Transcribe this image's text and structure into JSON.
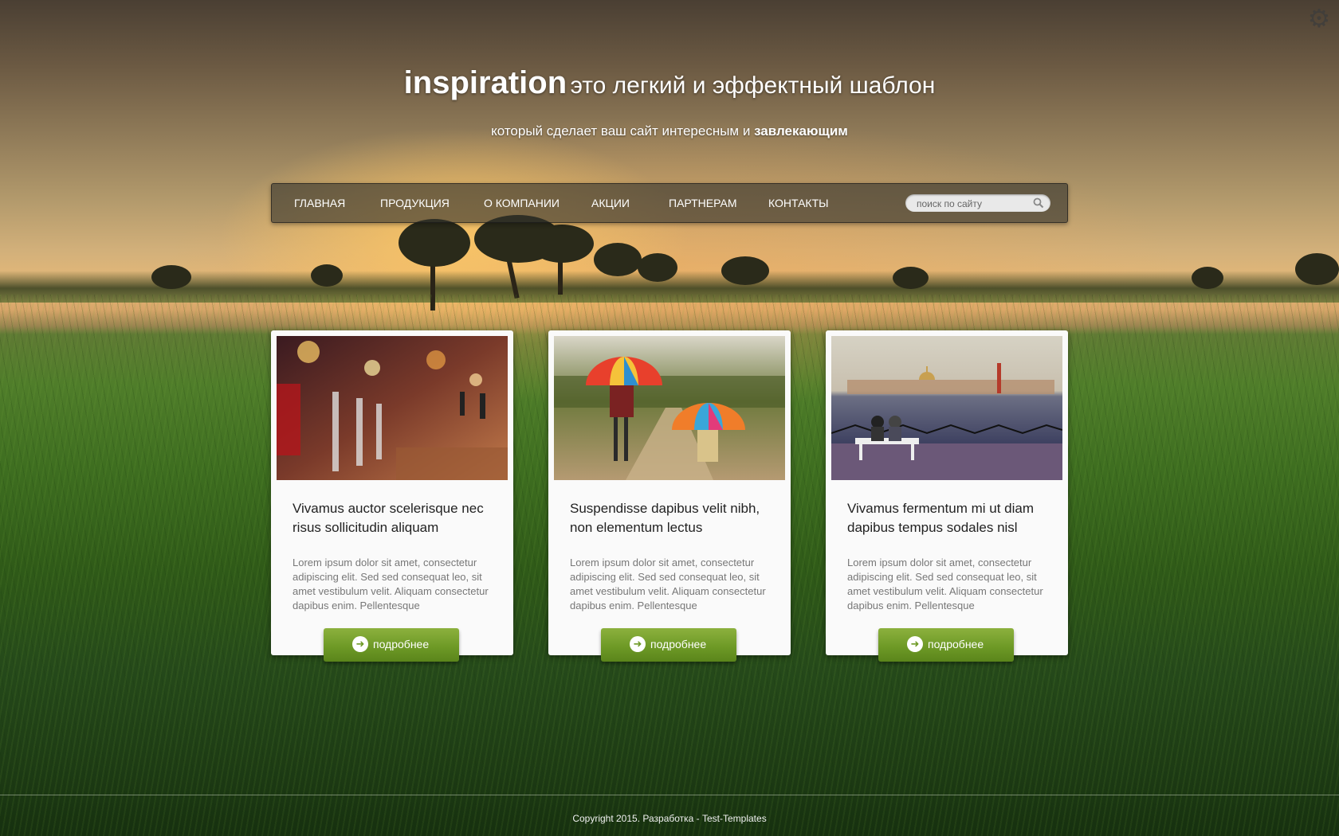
{
  "colors": {
    "accent_green": "#6e9a26",
    "nav_bg": "#32322d",
    "card_bg": "#fafafa"
  },
  "header": {
    "brand": "inspiration",
    "tagline": "это легкий и эффектный шаблон",
    "subtitle_prefix": "который сделает ваш сайт интересным и",
    "subtitle_bold": "завлекающим",
    "settings_icon": "gear-icon"
  },
  "nav": {
    "items": [
      {
        "label": "ГЛАВНАЯ"
      },
      {
        "label": "ПРОДУКЦИЯ"
      },
      {
        "label": "О КОМПАНИИ"
      },
      {
        "label": "АКЦИИ"
      },
      {
        "label": "ПАРТНЕРАМ"
      },
      {
        "label": "КОНТАКТЫ"
      }
    ],
    "search": {
      "placeholder": "поиск по сайту",
      "value": "",
      "icon": "search-icon"
    }
  },
  "cards": [
    {
      "image": "night-street-photo",
      "title": "Vivamus auctor scelerisque nec risus sollicitudin aliquam",
      "text": "Lorem ipsum dolor sit amet, consectetur adipiscing elit. Sed sed consequat leo, sit amet vestibulum velit. Aliquam consectetur dapibus enim. Pellentesque",
      "button": "подробнее"
    },
    {
      "image": "umbrellas-photo",
      "title": "Suspendisse dapibus velit nibh, non elementum lectus",
      "text": "Lorem ipsum dolor sit amet, consectetur adipiscing elit. Sed sed consequat leo, sit amet vestibulum velit. Aliquam consectetur dapibus enim. Pellentesque",
      "button": "подробнее"
    },
    {
      "image": "city-embankment-photo",
      "title": "Vivamus fermentum mi ut diam dapibus tempus sodales nisl",
      "text": "Lorem ipsum dolor sit amet, consectetur adipiscing elit. Sed sed consequat leo, sit amet vestibulum velit. Aliquam consectetur dapibus enim. Pellentesque",
      "button": "подробнее"
    }
  ],
  "footer": {
    "copyright": "Copyright 2015. Разработка - Test-Templates"
  }
}
